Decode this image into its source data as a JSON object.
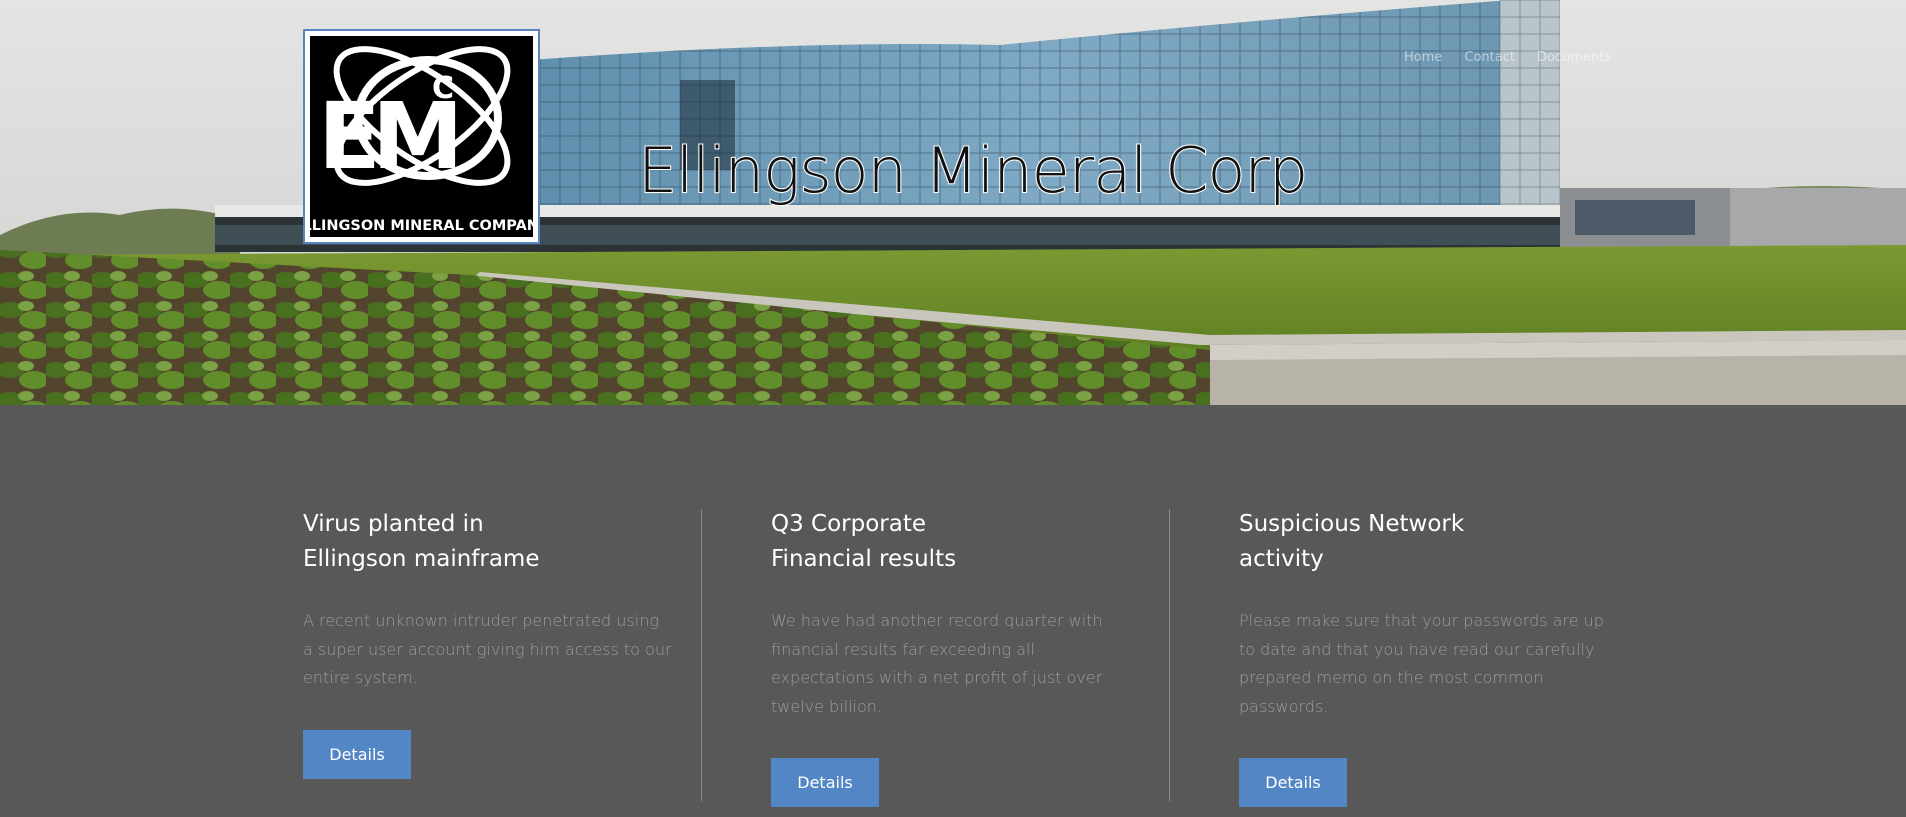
{
  "site": {
    "title": "Ellingson Mineral Corp",
    "logo": {
      "initials_e": "E",
      "initials_m": "M",
      "initials_c": "C",
      "company": "ELLINGSON MINERAL COMPANY"
    },
    "nav": [
      {
        "label": "Home"
      },
      {
        "label": "Contact"
      },
      {
        "label": "Documents"
      }
    ]
  },
  "articles": [
    {
      "title": "Virus planted in Ellingson mainframe",
      "body": "A recent unknown intruder penetrated using a super user account giving him access to our entire system.",
      "button": "Details"
    },
    {
      "title": "Q3 Corporate Financial results",
      "body": "We have had another record quarter with financial results far exceeding all expectations with a net profit of just over twelve billion.",
      "button": "Details"
    },
    {
      "title": "Suspicious Network activity",
      "body": "Please make sure that your passwords are up to date and that you have read our carefully prepared memo on the most common passwords.",
      "button": "Details"
    }
  ],
  "colors": {
    "page_bg": "#585858",
    "accent": "#5286c4",
    "heading": "#ffffff",
    "body_text": "#9c9c9c"
  }
}
